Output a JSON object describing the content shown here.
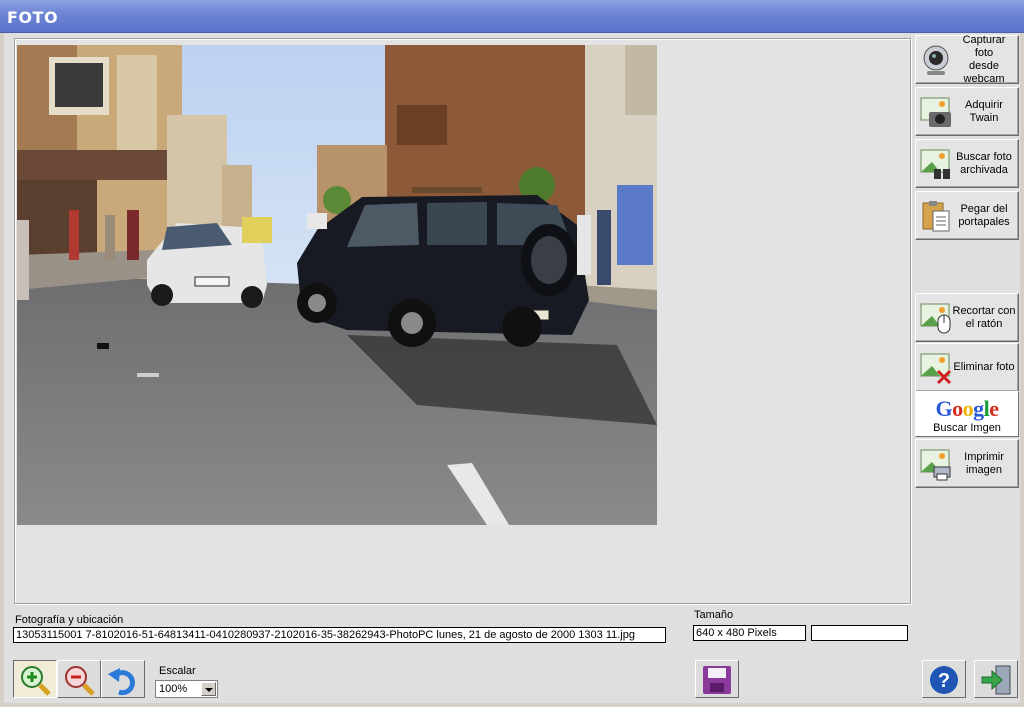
{
  "window": {
    "title": "FOTO"
  },
  "photo": {
    "description_alt": "Foto del accidente"
  },
  "side_buttons": [
    {
      "label": "Capturar foto\ndesde\nwebcam",
      "icon": "webcam-icon"
    },
    {
      "label": "Adquirir\nTwain",
      "icon": "camera-icon"
    },
    {
      "label": "Buscar foto\narchivada",
      "icon": "binoculars-icon"
    },
    {
      "label": "Pegar del\nportapales",
      "icon": "clipboard-icon"
    },
    {
      "label": "Recortar con\nel ratón",
      "icon": "mouse-crop-icon"
    },
    {
      "label": "Eliminar foto",
      "icon": "delete-photo-icon"
    },
    {
      "label": "Imprimir\nimagen",
      "icon": "printer-icon"
    }
  ],
  "google": {
    "logo": [
      "G",
      "o",
      "o",
      "g",
      "l",
      "e"
    ],
    "label": "Buscar Imgen"
  },
  "info": {
    "file_label": "Fotografía y ubicación",
    "file_value": "13053115001 7-8102016-51-64813411-0410280937-2102016-35-38262943-PhotoPC lunes, 21 de agosto de 2000 1303 11.jpg",
    "size_label": "Tamaño",
    "size_value": "640 x 480 Pixels",
    "extra_value": ""
  },
  "toolbar": {
    "scale_label": "Escalar",
    "scale_value": "100%"
  },
  "colors": {
    "title_bar": "#6f86d6",
    "save_icon": "#8a3a9a",
    "help_icon": "#1f55b5",
    "exit_arrow": "#3aa84a"
  }
}
